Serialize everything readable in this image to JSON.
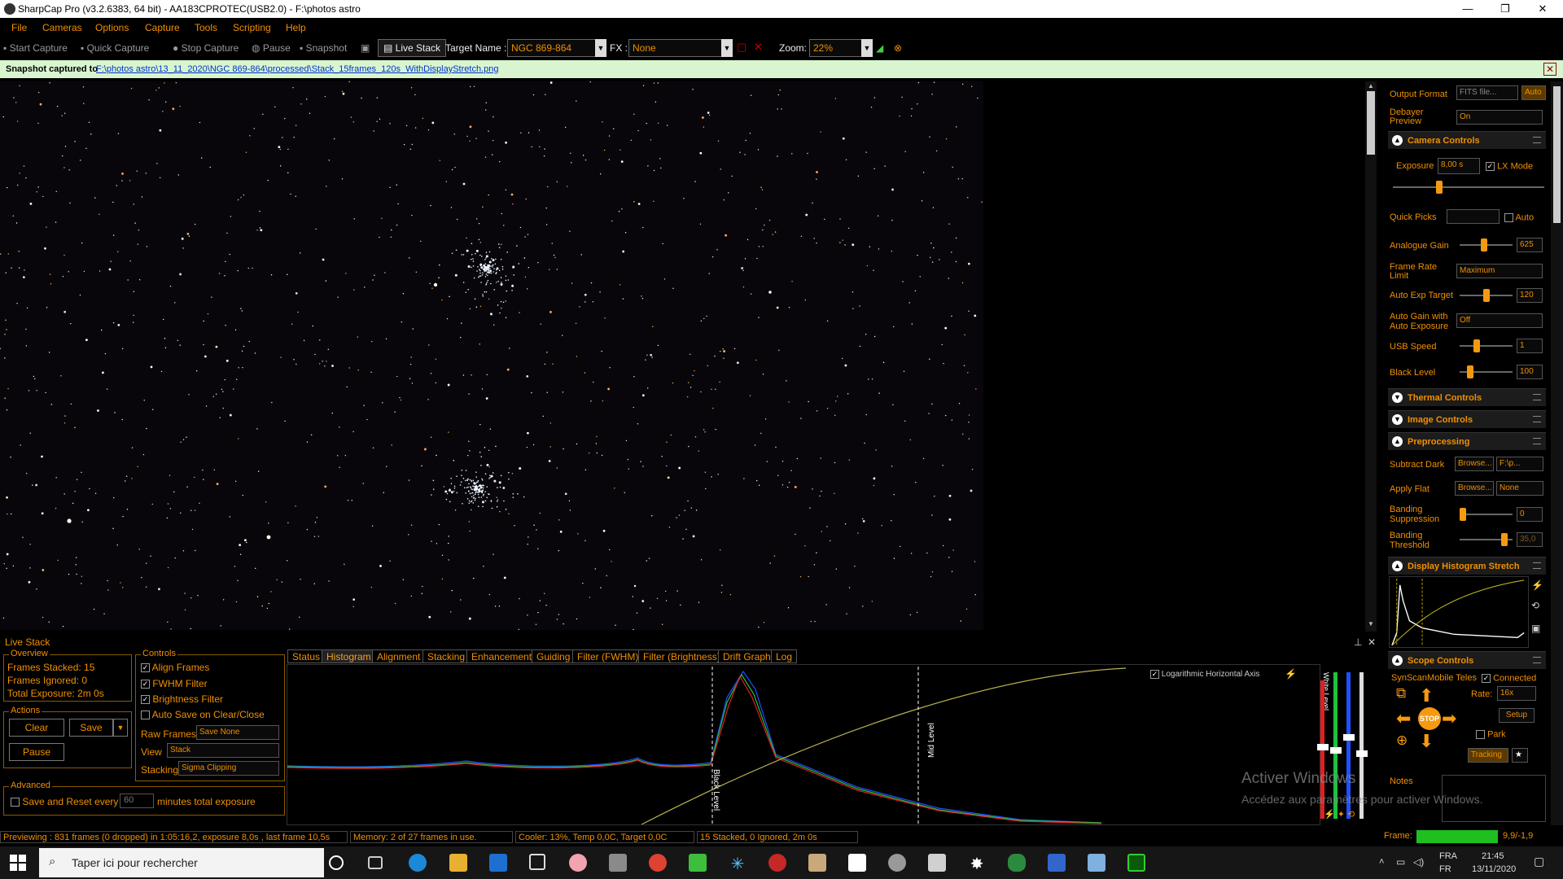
{
  "window": {
    "title": "SharpCap Pro (v3.2.6383, 64 bit) - AA183CPROTEC(USB2.0) - F:\\photos astro",
    "minimize": "—",
    "maximize": "❐",
    "close": "✕"
  },
  "menu": [
    "File",
    "Cameras",
    "Options",
    "Capture",
    "Tools",
    "Scripting",
    "Help"
  ],
  "toolbar": {
    "start_capture": "Start Capture",
    "quick_capture": "Quick Capture",
    "stop_capture": "Stop Capture",
    "pause": "Pause",
    "snapshot": "Snapshot",
    "live_stack": "Live Stack",
    "target_label": "Target Name :",
    "target_value": "NGC 869-864",
    "fx_label": "FX :",
    "fx_value": "None",
    "zoom_label": "Zoom:",
    "zoom_value": "22%"
  },
  "notification": {
    "bold": "Snapshot captured to",
    "path": "F:\\photos astro\\13_11_2020\\NGC 869-864\\processed\\Stack_15frames_120s_WithDisplayStretch.png",
    "close": "✕"
  },
  "right_panel": {
    "output_format_label": "Output Format",
    "output_format_value": "FITS file...",
    "auto_button": "Auto",
    "debayer_label_1": "Debayer",
    "debayer_label_2": "Preview",
    "debayer_value": "On",
    "camera_controls": "Camera Controls",
    "exposure_label": "Exposure",
    "exposure_value": "8,00 s",
    "lx_mode": "LX Mode",
    "quick_picks": "Quick Picks",
    "auto_label": "Auto",
    "analogue_gain": "Analogue Gain",
    "analogue_gain_value": "625",
    "analogue_gain_level": 0.45,
    "frame_rate_label_1": "Frame Rate",
    "frame_rate_label_2": "Limit",
    "frame_rate_value": "Maximum",
    "auto_exp_target": "Auto Exp Target",
    "auto_exp_target_value": "120",
    "auto_exp_level": 0.5,
    "auto_gain_label_1": "Auto Gain with",
    "auto_gain_label_2": "Auto Exposure",
    "auto_gain_value": "Off",
    "usb_speed": "USB Speed",
    "usb_speed_value": "1",
    "usb_speed_level": 0.3,
    "black_level": "Black Level",
    "black_level_value": "100",
    "black_level_level": 0.15,
    "thermal_controls": "Thermal Controls",
    "image_controls": "Image Controls",
    "preprocessing": "Preprocessing",
    "subtract_dark": "Subtract Dark",
    "browse": "Browse...",
    "dark_value": "F:\\p...",
    "apply_flat": "Apply Flat",
    "flat_value": "None",
    "banding_supp_1": "Banding",
    "banding_supp_2": "Suppression",
    "banding_supp_value": "0",
    "banding_supp_level": 0.0,
    "banding_thr_1": "Banding",
    "banding_thr_2": "Threshold",
    "banding_thr_value": "35,0",
    "banding_thr_level": 0.9,
    "display_histogram_stretch": "Display Histogram Stretch",
    "scope_controls": "Scope Controls",
    "scope_name": "SynScanMobile Teles",
    "connected": "Connected",
    "rate_label": "Rate:",
    "rate_value": "16x",
    "stop": "STOP",
    "setup": "Setup",
    "park": "Park",
    "tracking": "Tracking",
    "notes": "Notes",
    "frame_label": "Frame:",
    "frame_value": "9,9/-1,9"
  },
  "live_stack": {
    "title": "Live Stack",
    "overview": "Overview",
    "frames_stacked": "Frames Stacked:  15",
    "frames_ignored": "Frames Ignored:   0",
    "total_exposure": "Total Exposure:   2m 0s",
    "actions": "Actions",
    "clear": "Clear",
    "save": "Save",
    "pause": "Pause",
    "advanced": "Advanced",
    "save_reset": "Save and Reset every",
    "minutes_value": "60",
    "minutes_label": "minutes total exposure",
    "controls": "Controls",
    "align_frames": "Align Frames",
    "fwhm_filter": "FWHM Filter",
    "brightness_filter": "Brightness Filter",
    "auto_save": "Auto Save on Clear/Close",
    "raw_frames_label": "Raw Frames",
    "raw_frames_value": "Save None",
    "view_label": "View",
    "view_value": "Stack",
    "stacking_label": "Stacking",
    "stacking_value": "Sigma Clipping",
    "tabs": [
      "Status",
      "Histogram",
      "Alignment",
      "Stacking",
      "Enhancement",
      "Guiding",
      "Filter (FWHM)",
      "Filter (Brightness)",
      "Drift Graph",
      "Log"
    ],
    "log_axis": "Logarithmic Horizontal Axis",
    "black_level": "Black Level",
    "mid_level": "Mid Level",
    "white_level": "White Level"
  },
  "status": {
    "preview": "Previewing : 831 frames (0 dropped) in 1:05:16,2, exposure 8,0s , last frame 10,5s",
    "memory": "Memory: 2 of 27 frames in use.",
    "cooler": "Cooler: 13%, Temp 0,0C, Target 0,0C",
    "stack": "15 Stacked, 0 Ignored, 2m 0s"
  },
  "watermark": {
    "line1": "Activer Windows",
    "line2": "Accédez aux paramètres pour activer Windows."
  },
  "taskbar": {
    "search_placeholder": "Taper ici pour rechercher",
    "lang1": "FRA",
    "lang2": "FR",
    "time": "21:45",
    "date": "13/11/2020"
  },
  "colors": {
    "accent": "#f09000",
    "notify_bg": "#d8f5d0",
    "frame_bar": "#1fbf1f"
  }
}
